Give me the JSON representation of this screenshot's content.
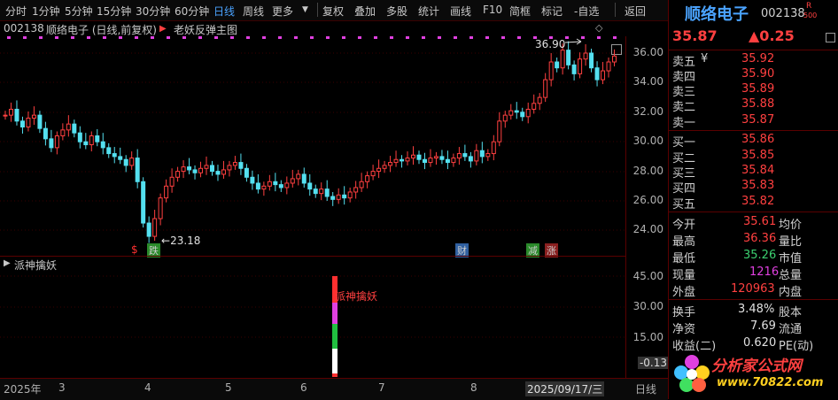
{
  "toolbar": {
    "items": [
      {
        "label": "分时"
      },
      {
        "label": "1分钟"
      },
      {
        "label": "5分钟"
      },
      {
        "label": "15分钟"
      },
      {
        "label": "30分钟"
      },
      {
        "label": "60分钟"
      },
      {
        "label": "日线"
      },
      {
        "label": "周线"
      },
      {
        "label": "更多"
      },
      {
        "label": "复权"
      },
      {
        "label": "叠加"
      },
      {
        "label": "多股"
      },
      {
        "label": "统计"
      },
      {
        "label": "画线"
      },
      {
        "label": "F10"
      },
      {
        "label": "简框"
      },
      {
        "label": "标记"
      },
      {
        "label": "-自选"
      },
      {
        "label": "返回"
      }
    ],
    "active": "日线"
  },
  "chart_header": {
    "code": "002138",
    "name_period": "顺络电子 (日线,前复权)",
    "indicator": "老妖反弹主图"
  },
  "main_chart": {
    "y_ticks": [
      "36.00",
      "34.00",
      "32.00",
      "30.00",
      "28.00",
      "26.00",
      "24.00"
    ],
    "high_label": "36.90",
    "low_label": "23.18",
    "markers": [
      {
        "text": "$",
        "color": "#ff3030"
      },
      {
        "text": "跌",
        "color": "#ffffff"
      },
      {
        "text": "财",
        "color": "#ffffff"
      },
      {
        "text": "减",
        "color": "#ffffff"
      },
      {
        "text": "涨",
        "color": "#ffffff"
      }
    ]
  },
  "sub_chart": {
    "title": "派神擒妖",
    "signal_label": "派神擒妖",
    "y_ticks": [
      "45.00",
      "30.00",
      "15.00"
    ],
    "current_value": "-0.13"
  },
  "x_axis": {
    "labels": [
      "2025年",
      "3",
      "4",
      "5",
      "6",
      "7",
      "8",
      "2025/09/17/三"
    ],
    "bottom_right": "日线"
  },
  "quote": {
    "name": "顺络电子",
    "code": "002138",
    "flag_r": "R",
    "flag_500": "500",
    "price": "35.87",
    "change": "▲0.25",
    "asks": [
      {
        "label": "卖五",
        "flag": "¥",
        "price": "35.92"
      },
      {
        "label": "卖四",
        "flag": "",
        "price": "35.90"
      },
      {
        "label": "卖三",
        "flag": "",
        "price": "35.89"
      },
      {
        "label": "卖二",
        "flag": "",
        "price": "35.88"
      },
      {
        "label": "卖一",
        "flag": "",
        "price": "35.87"
      }
    ],
    "bids": [
      {
        "label": "买一",
        "price": "35.86"
      },
      {
        "label": "买二",
        "price": "35.85"
      },
      {
        "label": "买三",
        "price": "35.84"
      },
      {
        "label": "买四",
        "price": "35.83"
      },
      {
        "label": "买五",
        "price": "35.82"
      }
    ],
    "stats": [
      {
        "label": "今开",
        "value": "35.61",
        "label2": "均价"
      },
      {
        "label": "最高",
        "value": "36.36",
        "label2": "量比"
      },
      {
        "label": "最低",
        "value": "35.26",
        "label2": "市值"
      },
      {
        "label": "现量",
        "value": "1216",
        "label2": "总量"
      },
      {
        "label": "外盘",
        "value": "120963",
        "label2": "内盘"
      }
    ],
    "stats2": [
      {
        "label": "换手",
        "value": "3.48%",
        "label2": "股本"
      },
      {
        "label": "净资",
        "value": "7.69",
        "label2": "流通"
      },
      {
        "label": "收益(二)",
        "value": "0.620",
        "label2": "PE(动)"
      }
    ]
  },
  "watermark": {
    "name": "分析家公式网",
    "url": "www.70822.com"
  },
  "colors": {
    "up": "#ff4040",
    "down": "#54e0f0",
    "green": "#3cd070",
    "purple": "#e040e0"
  }
}
